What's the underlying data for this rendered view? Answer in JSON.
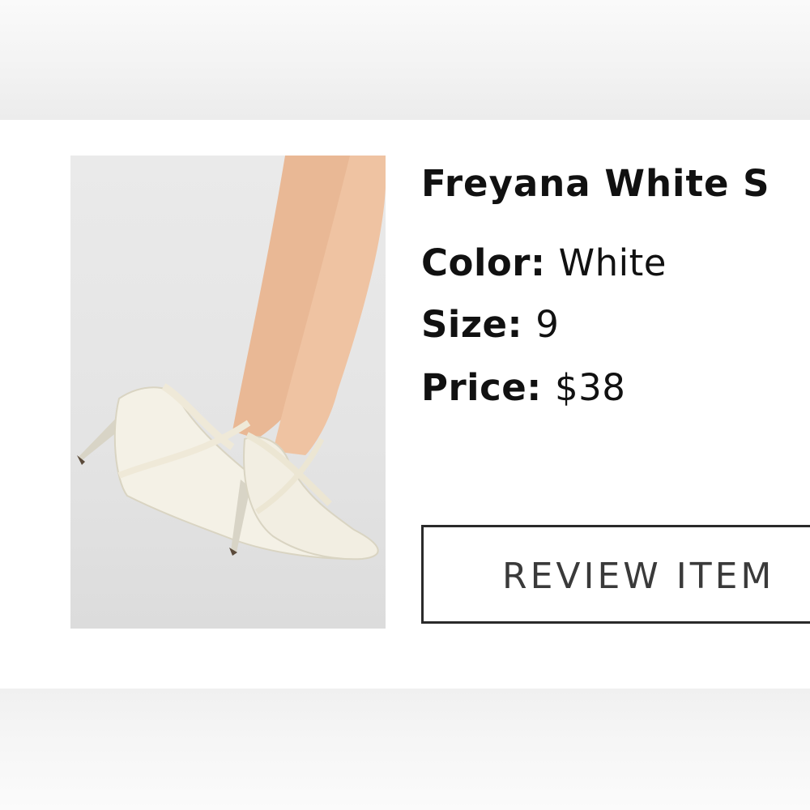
{
  "product": {
    "title": "Freyana White S",
    "image_icon": "white-satin-heels-photo",
    "details": [
      {
        "label": "Color:",
        "value": "White"
      },
      {
        "label": "Size:",
        "value": "9"
      },
      {
        "label": "Price:",
        "value": "$38"
      }
    ]
  },
  "actions": {
    "review_label": "REVIEW ITEM"
  },
  "colors": {
    "text": "#111111",
    "button_border": "#2a2a2a",
    "button_text": "#3a3a3a",
    "background": "#ffffff"
  }
}
